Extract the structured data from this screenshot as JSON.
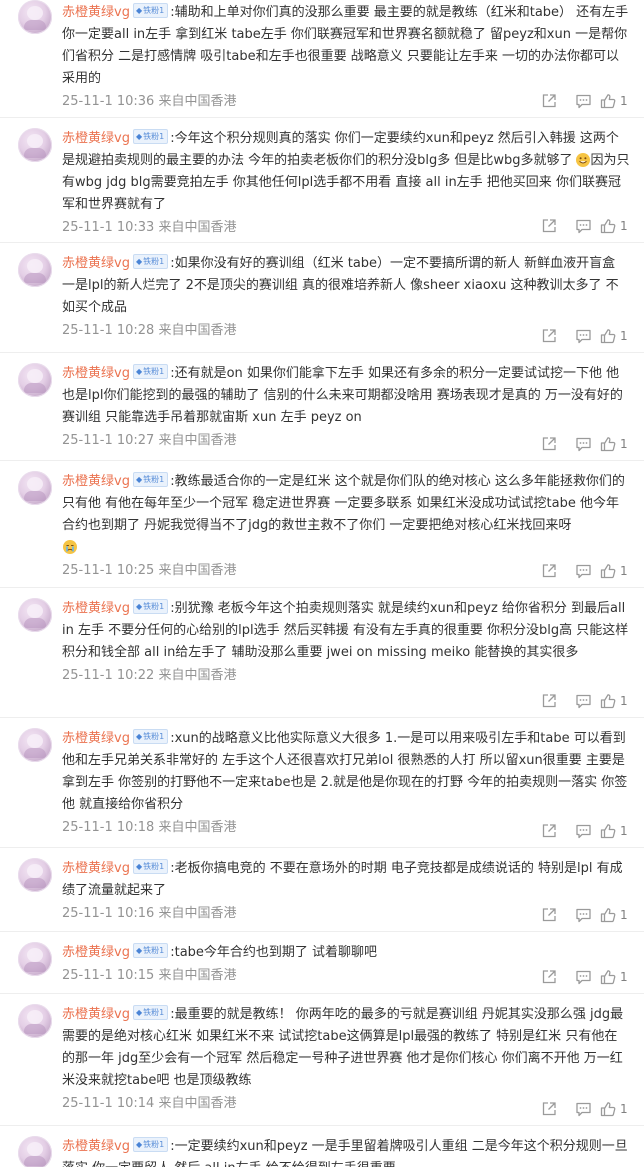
{
  "comments": [
    {
      "user": "赤橙黄绿vg",
      "badge": "铁粉1",
      "text": "辅助和上单对你们真的没那么重要 最主要的就是教练（红米和tabe） 还有左手 你一定要all in左手 拿到红米 tabe左手 你们联赛冠军和世界赛名额就稳了 留peyz和xun 一是帮你们省积分 二是打感情牌 吸引tabe和左手也很重要 战略意义 只要能让左手来 一切的办法你都可以采用的",
      "emoji": "",
      "meta": "25-11-1 10:36 来自中国香港",
      "likes": "1"
    },
    {
      "user": "赤橙黄绿vg",
      "badge": "铁粉1",
      "text": "今年这个积分规则真的落实 你们一定要续约xun和peyz 然后引入韩援 这两个是规避拍卖规则的最主要的办法 今年的拍卖老板你们的积分没blg多 但是比wbg多就够了",
      "emoji": "grin",
      "text2": "因为只有wbg jdg blg需要竞拍左手 你其他任何lpl选手都不用看 直接 all in左手 把他买回来 你们联赛冠军和世界赛就有了",
      "meta": "25-11-1 10:33 来自中国香港",
      "likes": "1"
    },
    {
      "user": "赤橙黄绿vg",
      "badge": "铁粉1",
      "text": "如果你没有好的赛训组（红米 tabe）一定不要搞所谓的新人 新鲜血液开盲盒 一是lpl的新人烂完了 2不是顶尖的赛训组 真的很难培养新人 像sheer xiaoxu 这种教训太多了 不如买个成品",
      "emoji": "",
      "meta": "25-11-1 10:28 来自中国香港",
      "likes": "1"
    },
    {
      "user": "赤橙黄绿vg",
      "badge": "铁粉1",
      "text": "还有就是on 如果你们能拿下左手 如果还有多余的积分一定要试试挖一下他 他也是lpl你们能挖到的最强的辅助了 信别的什么未来可期都没啥用 赛场表现才是真的 万一没有好的赛训组 只能靠选手吊着那就宙斯 xun 左手 peyz on",
      "emoji": "",
      "meta": "25-11-1 10:27 来自中国香港",
      "likes": "1"
    },
    {
      "user": "赤橙黄绿vg",
      "badge": "铁粉1",
      "text": "教练最适合你的一定是红米 这个就是你们队的绝对核心 这么多年能拯救你们的只有他 有他在每年至少一个冠军 稳定进世界赛 一定要多联系 如果红米没成功试试挖tabe 他今年合约也到期了 丹妮我觉得当不了jdg的救世主救不了你们 一定要把绝对核心红米找回来呀",
      "emoji": "cry",
      "meta": "25-11-1 10:25 来自中国香港",
      "likes": "1"
    },
    {
      "user": "赤橙黄绿vg",
      "badge": "铁粉1",
      "text": "别犹豫 老板今年这个拍卖规则落实 就是续约xun和peyz 给你省积分 到最后all in 左手 不要分任何的心给别的lpl选手 然后买韩援 有没有左手真的很重要 你积分没blg高 只能这样 积分和钱全部 all in给左手了 辅助没那么重要 jwei on missing meiko 能替换的其实很多",
      "emoji": "",
      "meta": "25-11-1 10:22 来自中国香港",
      "likes": "1"
    },
    {
      "user": "赤橙黄绿vg",
      "badge": "铁粉1",
      "text": "xun的战略意义比他实际意义大很多 1.一是可以用来吸引左手和tabe 可以看到他和左手兄弟关系非常好的 左手这个人还很喜欢打兄弟lol 很熟悉的人打 所以留xun很重要 主要是拿到左手 你签别的打野他不一定来tabe也是 2.就是他是你现在的打野 今年的拍卖规则一落实 你签他 就直接给你省积分",
      "emoji": "",
      "meta": "25-11-1 10:18 来自中国香港",
      "likes": "1"
    },
    {
      "user": "赤橙黄绿vg",
      "badge": "铁粉1",
      "text": "老板你搞电竞的 不要在意场外的时期 电子竞技都是成绩说话的 特别是lpl 有成绩了流量就起来了",
      "emoji": "",
      "meta": "25-11-1 10:16 来自中国香港",
      "likes": "1"
    },
    {
      "user": "赤橙黄绿vg",
      "badge": "铁粉1",
      "text": "tabe今年合约也到期了 试着聊聊吧",
      "emoji": "",
      "meta": "25-11-1 10:15 来自中国香港",
      "likes": "1"
    },
    {
      "user": "赤橙黄绿vg",
      "badge": "铁粉1",
      "text": "最重要的就是教练！ 你两年吃的最多的亏就是赛训组 丹妮其实没那么强 jdg最需要的是绝对核心红米 如果红米不来 试试挖tabe这俩算是lpl最强的教练了 特别是红米 只有他在的那一年 jdg至少会有一个冠军 然后稳定一号种子进世界赛 他才是你们核心 你们离不开他 万一红米没来就挖tabe吧 也是顶级教练",
      "emoji": "",
      "meta": "25-11-1 10:14 来自中国香港",
      "likes": "1"
    },
    {
      "user": "赤橙黄绿vg",
      "badge": "铁粉1",
      "text": "一定要续约xun和peyz 一是手里留着牌吸引人重组 二是今年这个积分规则一旦落实 你一定要留人 然后 all in左手 给不给得到左手很重要",
      "emoji": "",
      "meta": "",
      "likes": ""
    }
  ],
  "icons": {
    "share": "share-icon",
    "reply": "comment-icon",
    "like": "like-icon"
  }
}
